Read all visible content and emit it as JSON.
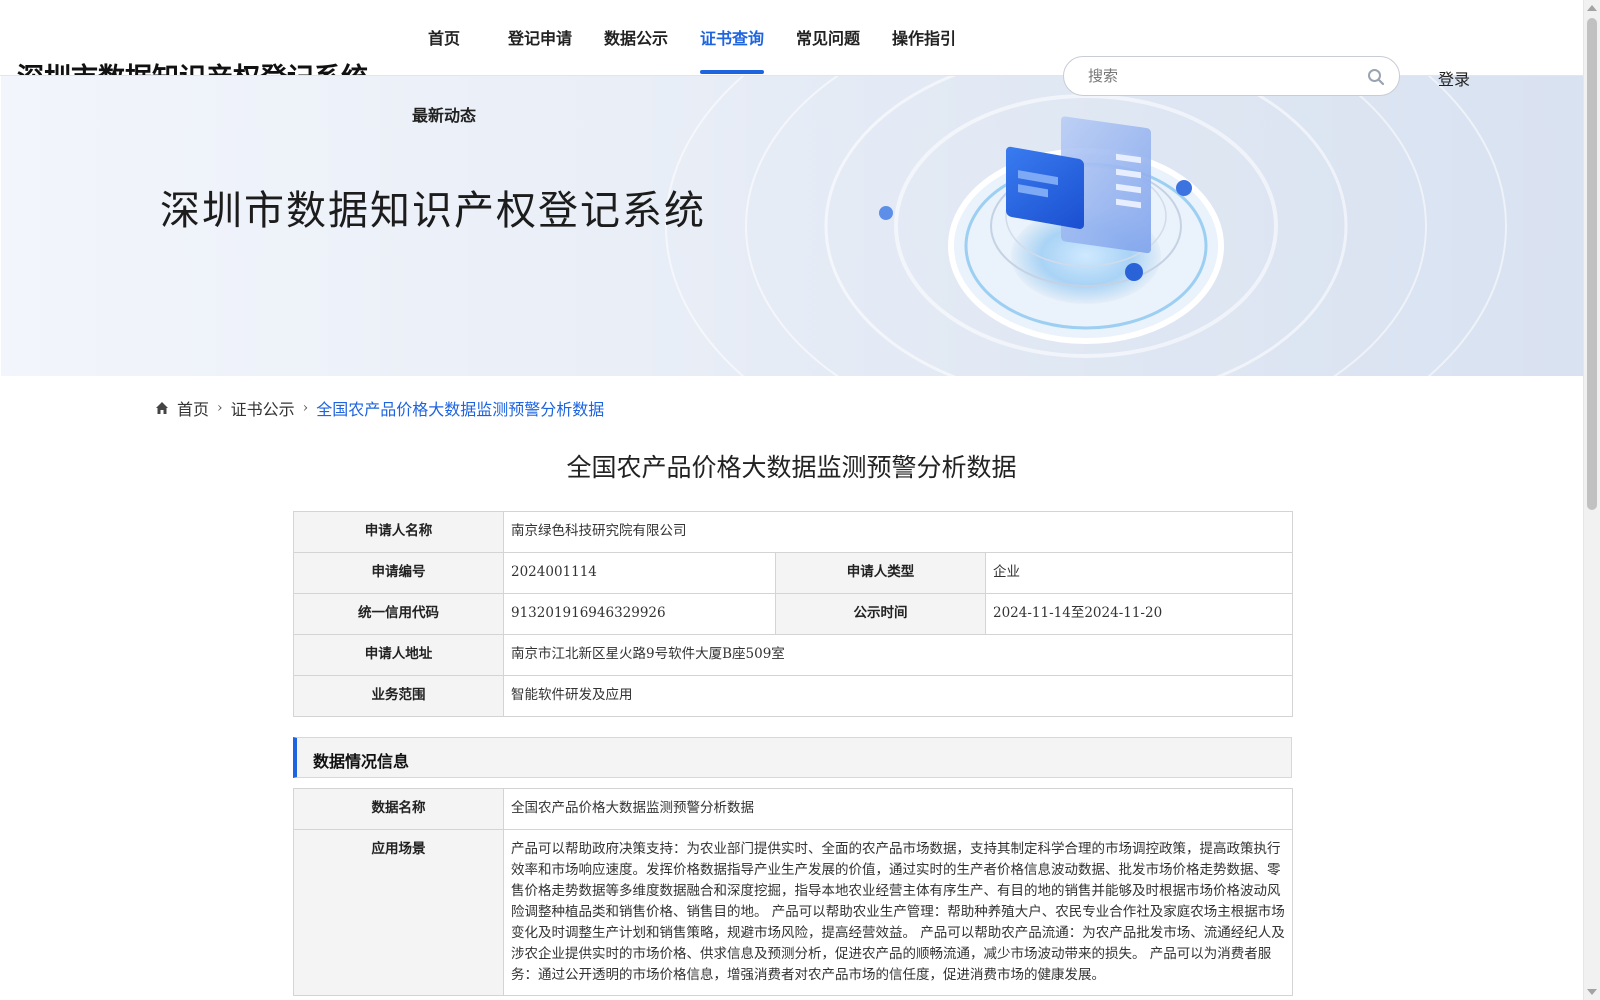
{
  "header": {
    "logo": "深圳市数据知识产权登记系统",
    "nav": [
      {
        "label": "首页"
      },
      {
        "label": "登记申请"
      },
      {
        "label": "数据公示"
      },
      {
        "label": "证书查询"
      },
      {
        "label": "常见问题"
      },
      {
        "label": "操作指引"
      }
    ],
    "nav_more": "最新动态",
    "active_nav": "证书查询",
    "search_placeholder": "搜索",
    "login": "登录",
    "accent_color": "#1e64e0"
  },
  "banner": {
    "title": "深圳市数据知识产权登记系统"
  },
  "breadcrumb": {
    "home": "首页",
    "level2": "证书公示",
    "current": "全国农产品价格大数据监测预警分析数据"
  },
  "page_title": "全国农产品价格大数据监测预警分析数据",
  "applicant": {
    "name_label": "申请人名称",
    "name": "南京绿色科技研究院有限公司",
    "number_label": "申请编号",
    "number": "2024001114",
    "type_label": "申请人类型",
    "type": "企业",
    "credit_label": "统一信用代码",
    "credit": "913201916946329926",
    "publish_label": "公示时间",
    "publish": "2024-11-14至2024-11-20",
    "address_label": "申请人地址",
    "address": "南京市江北新区星火路9号软件大厦B座509室",
    "scope_label": "业务范围",
    "scope": "智能软件研发及应用"
  },
  "data_section": {
    "heading": "数据情况信息",
    "data_name_label": "数据名称",
    "data_name": "全国农产品价格大数据监测预警分析数据",
    "scenario_label": "应用场景",
    "scenario": "产品可以帮助政府决策支持：为农业部门提供实时、全面的农产品市场数据，支持其制定科学合理的市场调控政策，提高政策执行效率和市场响应速度。发挥价格数据指导产业生产发展的价值，通过实时的生产者价格信息波动数据、批发市场价格走势数据、零售价格走势数据等多维度数据融合和深度挖掘，指导本地农业经营主体有序生产、有目的地的销售并能够及时根据市场价格波动风险调整种植品类和销售价格、销售目的地。 产品可以帮助农业生产管理：帮助种养殖大户、农民专业合作社及家庭农场主根据市场变化及时调整生产计划和销售策略，规避市场风险，提高经营效益。 产品可以帮助农产品流通：为农产品批发市场、流通经纪人及涉农企业提供实时的市场价格、供求信息及预测分析，促进农产品的顺畅流通，减少市场波动带来的损失。 产品可以为消费者服务：通过公开透明的市场价格信息，增强消费者对农产品市场的信任度，促进消费市场的健康发展。"
  }
}
